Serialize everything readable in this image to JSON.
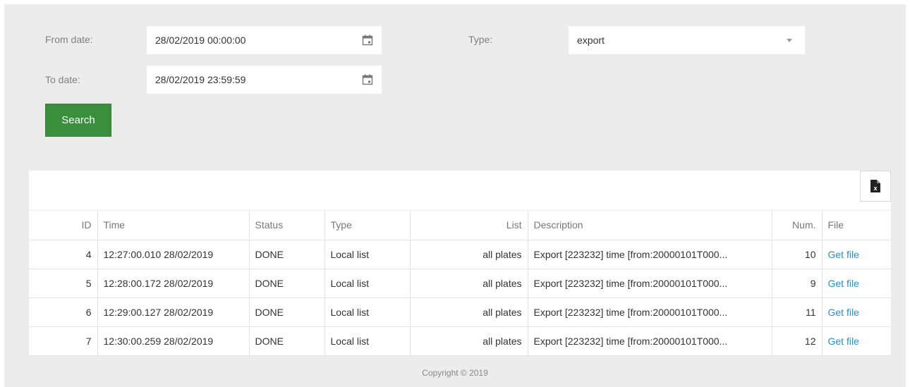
{
  "filters": {
    "from_label": "From date:",
    "from_value": "28/02/2019 00:00:00",
    "to_label": "To date:",
    "to_value": "28/02/2019 23:59:59",
    "type_label": "Type:",
    "type_value": "export",
    "search_label": "Search"
  },
  "toolbar": {
    "export_icon": "excel-export-icon"
  },
  "table": {
    "headers": [
      "ID",
      "Time",
      "Status",
      "Type",
      "List",
      "Description",
      "Num.",
      "File"
    ],
    "rows": [
      [
        "4",
        "12:27:00.010 28/02/2019",
        "DONE",
        "Local list",
        "all plates",
        "Export [223232] time [from:20000101T000...",
        "10",
        "Get file"
      ],
      [
        "5",
        "12:28:00.172 28/02/2019",
        "DONE",
        "Local list",
        "all plates",
        "Export [223232] time [from:20000101T000...",
        "9",
        "Get file"
      ],
      [
        "6",
        "12:29:00.127 28/02/2019",
        "DONE",
        "Local list",
        "all plates",
        "Export [223232] time [from:20000101T000...",
        "11",
        "Get file"
      ],
      [
        "7",
        "12:30:00.259 28/02/2019",
        "DONE",
        "Local list",
        "all plates",
        "Export [223232] time [from:20000101T000...",
        "12",
        "Get file"
      ]
    ]
  },
  "footer": {
    "copyright": "Copyright © 2019"
  },
  "colors": {
    "primary": "#3a8f3c",
    "link": "#1e90d8",
    "panel_bg": "#ececec"
  }
}
